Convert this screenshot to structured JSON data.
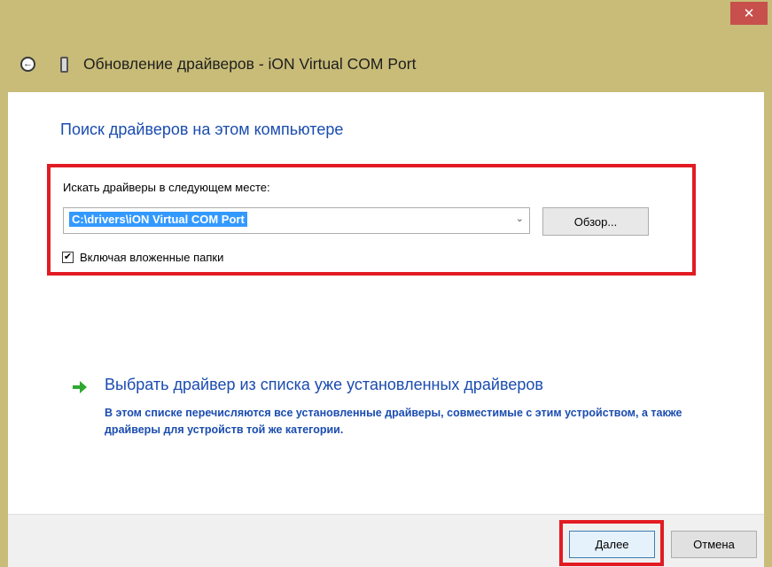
{
  "window": {
    "close_glyph": "✕",
    "title": "Обновление драйверов - iON Virtual COM Port",
    "frame_color": "#c8bc78"
  },
  "search": {
    "heading": "Поиск драйверов на этом компьютере",
    "label": "Искать драйверы в следующем месте:",
    "path_value": "C:\\drivers\\iON Virtual COM Port",
    "browse_label": "Обзор...",
    "include_subfolders_label": "Включая вложенные папки",
    "include_subfolders_checked": true
  },
  "pick_option": {
    "link_text": "Выбрать драйвер из списка уже установленных драйверов",
    "description": "В этом списке перечисляются все установленные драйверы, совместимые с этим устройством, а также драйверы для устройств той же категории."
  },
  "footer": {
    "next_label": "Далее",
    "cancel_label": "Отмена"
  },
  "annotations": {
    "highlight_color": "#e21b23"
  }
}
